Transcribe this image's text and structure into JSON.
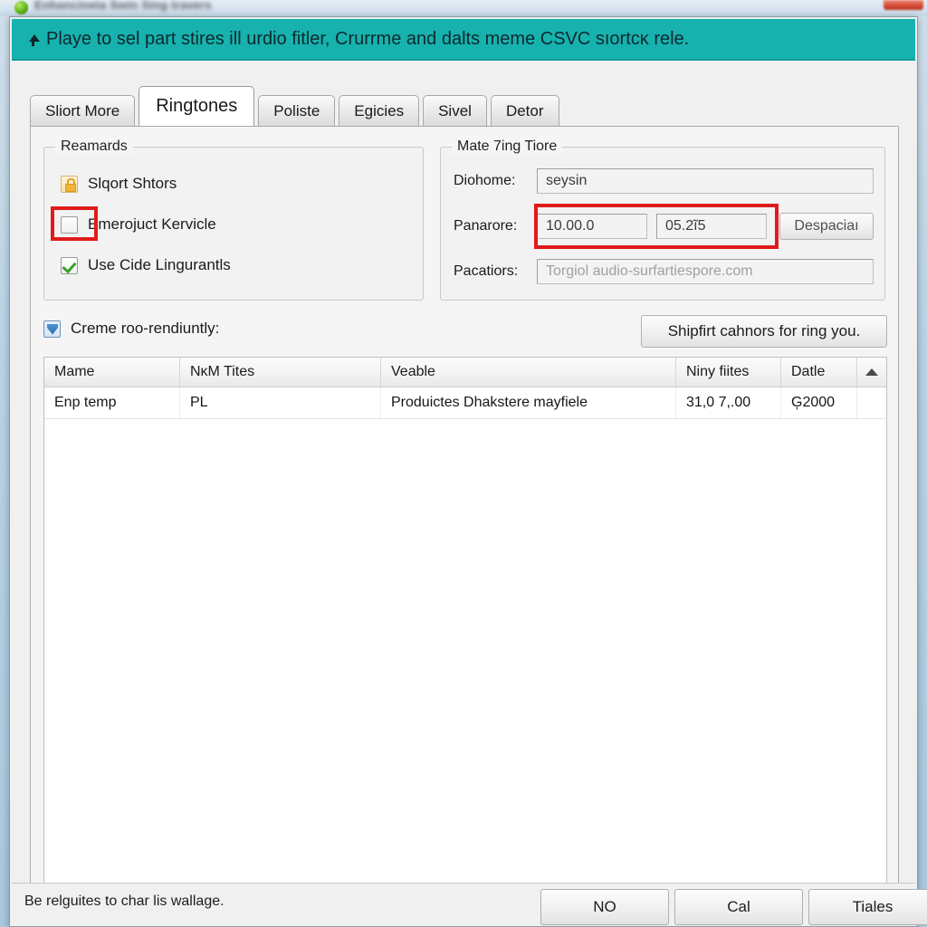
{
  "window": {
    "parent_title": "Enhancineta  Swin Sing travers",
    "app_icon": "app-globe-icon",
    "close_button": "close-window-button"
  },
  "banner": {
    "icon": "up-arrow-icon",
    "text": "Playe to sel part stires ill urdio fitler, Crurrme and dalts mеme CSVC sıortcĸ rele.",
    "background_color": "#17b2ad",
    "text_color": "#0d2830"
  },
  "tabs": [
    {
      "label": "Sliort More",
      "active": false
    },
    {
      "label": "Ringtones",
      "active": true
    },
    {
      "label": "Poliste",
      "active": false
    },
    {
      "label": "Egicies",
      "active": false
    },
    {
      "label": "Sivel",
      "active": false
    },
    {
      "label": "Detor",
      "active": false
    }
  ],
  "rewards_group": {
    "legend": "Reamards",
    "items": [
      {
        "label": "Slqort Shtors",
        "icon": "lock-icon",
        "state": "locked"
      },
      {
        "label": "Emerojuct Kervicle",
        "icon": "checkbox-icon",
        "state": "unchecked",
        "highlighted": true
      },
      {
        "label": "Use Cide Lingurantls",
        "icon": "checkbox-icon",
        "state": "checked"
      }
    ]
  },
  "mate_group": {
    "legend": "Mate 7ing Tiore",
    "fields": [
      {
        "label": "Diohome:",
        "value": "seysin",
        "is_placeholder": false
      },
      {
        "label": "Panarore:",
        "value": "10.00.0",
        "value2": "05.2ĩ5",
        "is_placeholder": false
      },
      {
        "label": "Pacatiors:",
        "value": "Torgiol audio-surfartiespore.com",
        "is_placeholder": true
      }
    ],
    "action_button": "Despaciaı"
  },
  "mid_row": {
    "checkbox_label": "Creme roo-rendiuntly:",
    "checkbox_state": "checked",
    "checkbox_icon": "blue-checkbox-icon",
    "button_label": "Shipfirt cahnors for ring you."
  },
  "table": {
    "columns": [
      "Mame",
      "NĸM Tites",
      "Veable",
      "Niny fiites",
      "Datle",
      ""
    ],
    "sort_icon": "sort-ascending-icon",
    "rows": [
      [
        "Enp temp",
        "PL",
        "Produictes Dhakstere mayfiele",
        "31,0 7,.00",
        "Ģ2000",
        ""
      ]
    ]
  },
  "bottom": {
    "status_text": "Be relguites to char lis wallage.",
    "buttons": [
      {
        "label": "NO"
      },
      {
        "label": "Cal"
      },
      {
        "label": "Tiales"
      }
    ]
  },
  "highlights": {
    "color": "#e01b1b"
  }
}
